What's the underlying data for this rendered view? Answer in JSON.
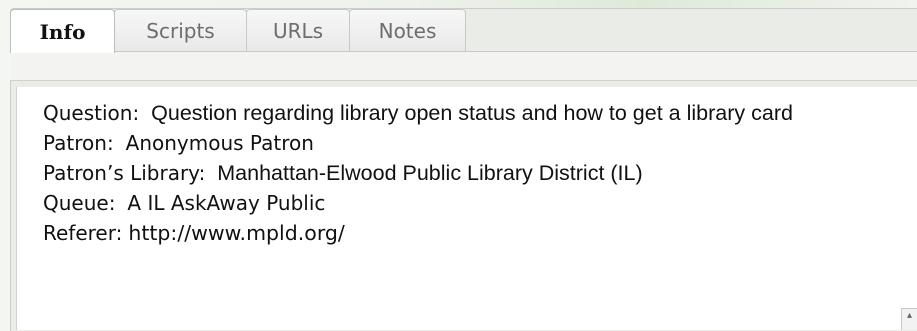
{
  "tabs": [
    {
      "label": "Info",
      "active": true
    },
    {
      "label": "Scripts",
      "active": false
    },
    {
      "label": "URLs",
      "active": false
    },
    {
      "label": "Notes",
      "active": false
    }
  ],
  "info": {
    "question_label": "Question:",
    "question_value": "Question regarding library open status and how to get a library card",
    "patron_label": "Patron:",
    "patron_value": "Anonymous Patron",
    "patron_library_label": "Patron’s Library:",
    "patron_library_value": "Manhattan-Elwood Public Library District (IL)",
    "queue_label": "Queue:",
    "queue_value": "A IL AskAway Public",
    "referer_label": "Referer:",
    "referer_value": "http://www.mpld.org/"
  },
  "icons": {
    "scroll": "scroll-arrow-icon"
  }
}
